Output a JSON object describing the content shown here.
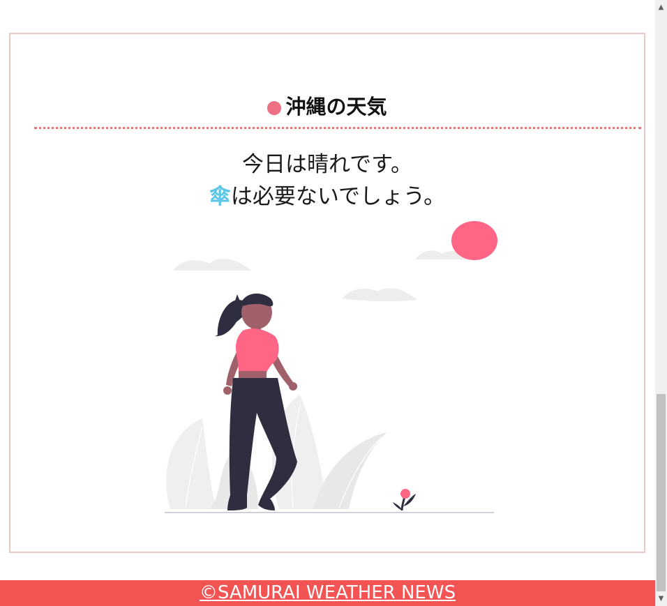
{
  "card": {
    "title": "沖縄の天気",
    "forecast_line1": "今日は晴れです。",
    "umbrella_char": "傘",
    "forecast_line2_rest": "は必要ないでしょう。"
  },
  "illustration": {
    "description_icon": "sunny-woman-illustration"
  },
  "footer": {
    "copyright": "©SAMURAI WEATHER NEWS"
  },
  "colors": {
    "accent": "#ec6f86",
    "footer_bg": "#f25454",
    "umbrella": "#5bc6e8",
    "card_border": "#ecc7c7",
    "sun": "#ff6584"
  }
}
